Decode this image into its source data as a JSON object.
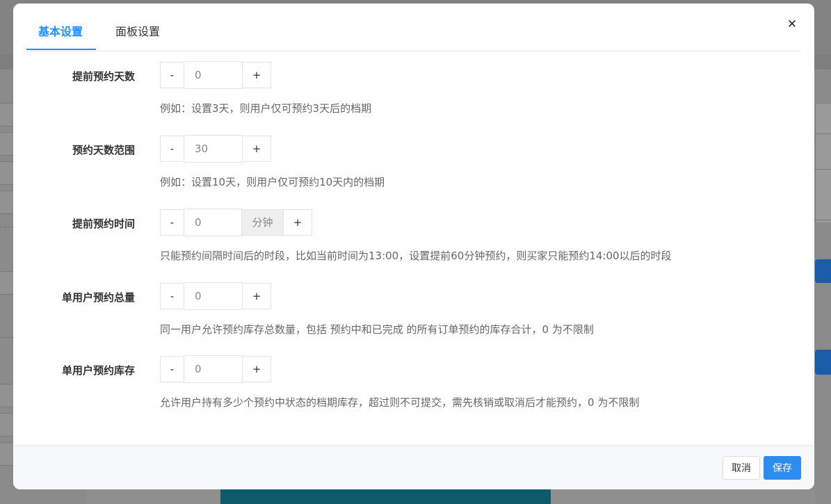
{
  "tabs": [
    {
      "label": "基本设置",
      "active": true
    },
    {
      "label": "面板设置",
      "active": false
    }
  ],
  "close_icon": "close-icon",
  "fields": {
    "advance_days": {
      "label": "提前预约天数",
      "value": "0",
      "minus": "-",
      "plus": "+",
      "hint": "例如：设置3天，则用户仅可预约3天后的档期"
    },
    "range_days": {
      "label": "预约天数范围",
      "value": "30",
      "minus": "-",
      "plus": "+",
      "hint": "例如：设置10天，则用户仅可预约10天内的档期"
    },
    "advance_time": {
      "label": "提前预约时间",
      "value": "0",
      "unit": "分钟",
      "minus": "-",
      "plus": "+",
      "hint": "只能预约间隔时间后的时段，比如当前时间为13:00，设置提前60分钟预约，则买家只能预约14:00以后的时段"
    },
    "user_total": {
      "label": "单用户预约总量",
      "value": "0",
      "minus": "-",
      "plus": "+",
      "hint": "同一用户允许预约库存总数量，包括 预约中和已完成 的所有订单预约的库存合计，0 为不限制"
    },
    "user_stock": {
      "label": "单用户预约库存",
      "value": "0",
      "minus": "-",
      "plus": "+",
      "hint": "允许用户持有多少个预约中状态的档期库存，超过则不可提交，需先核销或取消后才能预约，0 为不限制"
    }
  },
  "footer": {
    "cancel_label": "取消",
    "save_label": "保存"
  },
  "colors": {
    "accent": "#1890ff",
    "save_button": "#2d8cf0"
  }
}
